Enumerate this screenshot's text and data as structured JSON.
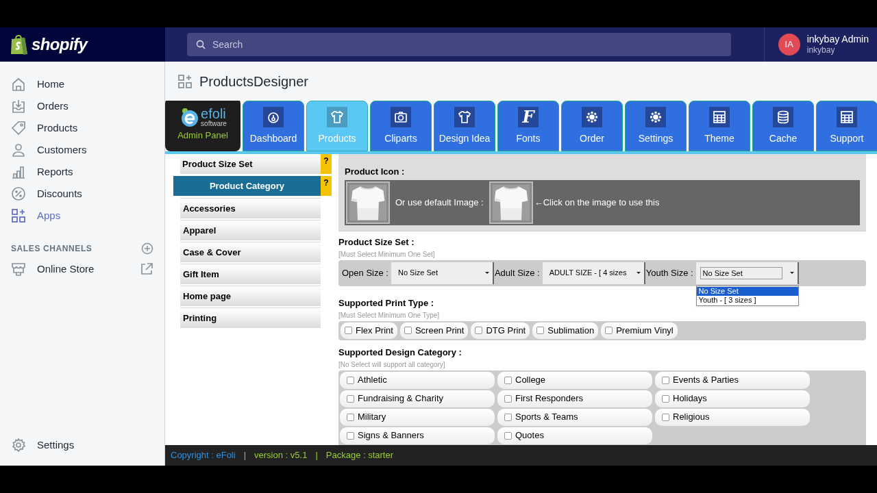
{
  "topbar": {
    "logo_text": "shopify",
    "search": {
      "placeholder": "Search"
    },
    "user": {
      "initials": "IA",
      "name": "inkybay Admin",
      "store": "inkybay"
    }
  },
  "sidebar": {
    "items": [
      {
        "label": "Home",
        "selected": false
      },
      {
        "label": "Orders",
        "selected": false
      },
      {
        "label": "Products",
        "selected": false
      },
      {
        "label": "Customers",
        "selected": false
      },
      {
        "label": "Reports",
        "selected": false
      },
      {
        "label": "Discounts",
        "selected": false
      },
      {
        "label": "Apps",
        "selected": true
      }
    ],
    "channels_heading": "SALES CHANNELS",
    "channels": [
      {
        "label": "Online Store",
        "selected": false
      }
    ],
    "settings": "Settings"
  },
  "page_title": "ProductsDesigner",
  "app_logo": {
    "name": "efoli",
    "sub": "software",
    "caption": "Admin Panel"
  },
  "tabs": [
    {
      "label": "Dashboard",
      "selected": false
    },
    {
      "label": "Products",
      "selected": true
    },
    {
      "label": "Cliparts",
      "selected": false
    },
    {
      "label": "Design Idea",
      "selected": false
    },
    {
      "label": "Fonts",
      "glyph": "F",
      "selected": false
    },
    {
      "label": "Order",
      "selected": false
    },
    {
      "label": "Settings",
      "selected": false
    },
    {
      "label": "Theme",
      "selected": false
    },
    {
      "label": "Cache",
      "selected": false
    },
    {
      "label": "Support",
      "selected": false
    }
  ],
  "categories": [
    {
      "label": "Product Size Set",
      "kind": "section",
      "help": "?",
      "selected": false
    },
    {
      "label": "Product Category",
      "kind": "section",
      "help": "?",
      "selected": true
    },
    {
      "label": "Accessories",
      "kind": "item",
      "selected": false
    },
    {
      "label": "Apparel",
      "kind": "item",
      "selected": false
    },
    {
      "label": "Case & Cover",
      "kind": "item",
      "selected": false
    },
    {
      "label": "Gift Item",
      "kind": "item",
      "selected": false
    },
    {
      "label": "Home page",
      "kind": "item",
      "selected": false
    },
    {
      "label": "Printing",
      "kind": "item",
      "selected": false
    }
  ],
  "product_icon": {
    "label": "Product Icon :",
    "default_text": "Or use default Image :",
    "hint": "←Click on the image to use this"
  },
  "size_set": {
    "label": "Product Size Set :",
    "note": "[Must Select Minimum One Set]",
    "selects": [
      {
        "label": "Open Size :",
        "value": "No Size Set",
        "open": false
      },
      {
        "label": "Adult Size :",
        "value": "ADULT SIZE - [ 4 sizes",
        "open": false
      },
      {
        "label": "Youth Size :",
        "value": "No Size Set",
        "open": true,
        "options": [
          {
            "label": "No Size Set",
            "selected": true
          },
          {
            "label": "Youth - [ 3 sizes ]",
            "selected": false
          }
        ]
      }
    ]
  },
  "print_type": {
    "label": "Supported Print Type :",
    "note": "[Must Select Minimum One Type]",
    "options": [
      {
        "label": "Flex Print",
        "checked": false
      },
      {
        "label": "Screen Print",
        "checked": false
      },
      {
        "label": "DTG Print",
        "checked": false
      },
      {
        "label": "Sublimation",
        "checked": false
      },
      {
        "label": "Premium Vinyl",
        "checked": false
      }
    ]
  },
  "design_category": {
    "label": "Supported Design Category :",
    "note": "[No Select will support all category]",
    "options": [
      {
        "label": "Athletic",
        "checked": false
      },
      {
        "label": "College",
        "checked": false
      },
      {
        "label": "Events & Parties",
        "checked": false
      },
      {
        "label": "Fundraising & Charity",
        "checked": false
      },
      {
        "label": "First Responders",
        "checked": false
      },
      {
        "label": "Holidays",
        "checked": false
      },
      {
        "label": "Military",
        "checked": false
      },
      {
        "label": "Sports & Teams",
        "checked": false
      },
      {
        "label": "Religious",
        "checked": false
      },
      {
        "label": "Signs & Banners",
        "checked": false
      },
      {
        "label": "Quotes",
        "checked": false
      }
    ]
  },
  "footer": {
    "copyright": "Copyright : eFoli",
    "version": "version : v5.1",
    "package": "Package : starter",
    "separator": "|"
  }
}
